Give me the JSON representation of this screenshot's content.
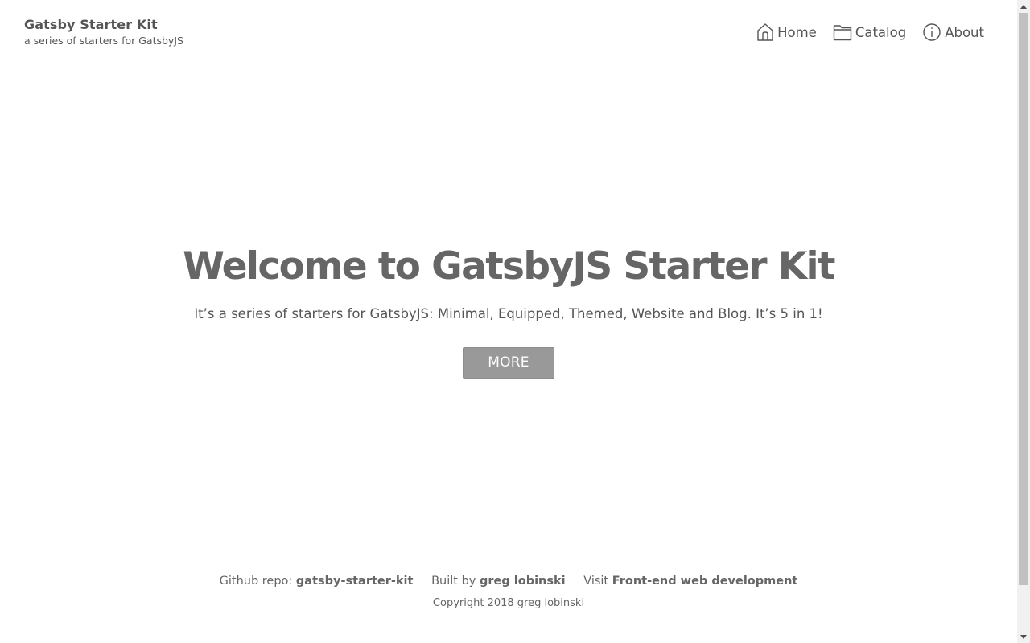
{
  "header": {
    "title": "Gatsby Starter Kit",
    "subtitle": "a series of starters for GatsbyJS",
    "nav": [
      {
        "label": "Home",
        "icon": "home-icon"
      },
      {
        "label": "Catalog",
        "icon": "folder-icon"
      },
      {
        "label": "About",
        "icon": "info-icon"
      }
    ]
  },
  "hero": {
    "title": "Welcome to GatsbyJS Starter Kit",
    "text": "It’s a series of starters for GatsbyJS: Minimal, Equipped, Themed, Website and Blog. It’s 5 in 1!",
    "button_label": "MORE"
  },
  "footer": {
    "github_prefix": "Github repo: ",
    "github_link": "gatsby-starter-kit",
    "built_prefix": "Built by ",
    "built_link": "greg lobinski",
    "visit_prefix": "Visit ",
    "visit_link": "Front-end web development",
    "copyright": "Copyright 2018 greg lobinski"
  },
  "colors": {
    "text": "#555555",
    "button_bg": "#999999",
    "button_text": "#ffffff",
    "scrollbar_track": "#f1f1f1",
    "scrollbar_thumb": "#c1c1c1"
  }
}
